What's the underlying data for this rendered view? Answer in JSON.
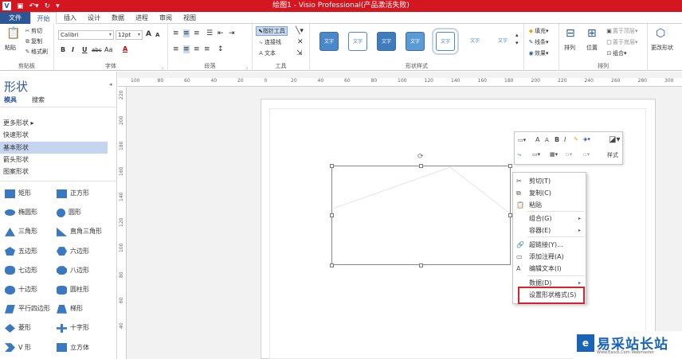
{
  "titlebar": {
    "title": "绘图1 - Visio Professional(产品激活失败)",
    "app_logo": "V",
    "quick_access": [
      "save-icon",
      "undo-icon",
      "redo-icon"
    ]
  },
  "tabs": [
    {
      "label": "文件"
    },
    {
      "label": "开始"
    },
    {
      "label": "插入"
    },
    {
      "label": "设计"
    },
    {
      "label": "数据"
    },
    {
      "label": "进程"
    },
    {
      "label": "审阅"
    },
    {
      "label": "视图"
    }
  ],
  "ribbon": {
    "clipboard": {
      "label": "剪贴板",
      "paste": "粘贴",
      "cut": "剪切",
      "copy": "复制",
      "format_painter": "格式刷"
    },
    "font": {
      "label": "字体",
      "font_name": "Calibri",
      "font_size": "12pt",
      "grow": "A",
      "shrink": "A",
      "bold": "B",
      "italic": "I",
      "underline": "U",
      "strike": "abc",
      "case": "Aa",
      "color": "A"
    },
    "paragraph": {
      "label": "段落"
    },
    "tools": {
      "label": "工具",
      "pointer": "指针工具",
      "connector": "连接线",
      "text": "文本"
    },
    "shape_styles": {
      "label": "形状样式",
      "style_text": "文字",
      "fill": "填充",
      "line": "线条",
      "effect": "效果"
    },
    "arrange": {
      "label": "排列",
      "arrange": "排列",
      "position": "位置",
      "bring_front": "置于顶层",
      "send_back": "置于底层",
      "group": "组合"
    },
    "edit": {
      "change_shape": "更改形状"
    }
  },
  "left_pane": {
    "title": "形状",
    "tab_stencil": "模具",
    "tab_search": "搜索",
    "more_shapes": "更多形状",
    "categories": [
      "快速形状",
      "基本形状",
      "箭头形状",
      "图案形状"
    ],
    "selected_category": "基本形状",
    "shapes": [
      [
        "矩形",
        "正方形"
      ],
      [
        "椭圆形",
        "圆形"
      ],
      [
        "三角形",
        "直角三角形"
      ],
      [
        "五边形",
        "六边形"
      ],
      [
        "七边形",
        "八边形"
      ],
      [
        "十边形",
        "圆柱形"
      ],
      [
        "平行四边形",
        "梯形"
      ],
      [
        "菱形",
        "十字形"
      ],
      [
        "V 形",
        "立方体"
      ]
    ]
  },
  "ruler": {
    "h_ticks": [
      "100",
      "80",
      "60",
      "40",
      "20",
      "0",
      "20",
      "40",
      "60",
      "80",
      "100",
      "120",
      "140",
      "160",
      "180",
      "200",
      "220",
      "240",
      "260",
      "280",
      "300"
    ],
    "v_ticks": [
      "220",
      "200",
      "180",
      "160",
      "140",
      "120",
      "100",
      "80",
      "60",
      "40"
    ]
  },
  "mini_toolbar": {
    "grow": "A",
    "shrink": "A",
    "bold": "B",
    "italic": "I",
    "style": "样式"
  },
  "context_menu": {
    "items": [
      {
        "label": "剪切(T)",
        "icon": "scissors-icon",
        "submenu": false
      },
      {
        "label": "复制(C)",
        "icon": "copy-icon",
        "submenu": false
      },
      {
        "label": "粘贴",
        "icon": "paste-icon",
        "submenu": false
      },
      {
        "label": "组合(G)",
        "icon": "",
        "submenu": true
      },
      {
        "label": "容器(E)",
        "icon": "",
        "submenu": true
      },
      {
        "label": "超链接(Y)...",
        "icon": "hyperlink-icon",
        "submenu": false
      },
      {
        "label": "添加注释(A)",
        "icon": "comment-icon",
        "submenu": false
      },
      {
        "label": "编辑文本(I)",
        "icon": "text-icon",
        "submenu": false
      },
      {
        "label": "数据(D)",
        "icon": "",
        "submenu": true
      },
      {
        "label": "设置形状格式(S)",
        "icon": "",
        "submenu": false
      }
    ]
  },
  "watermark": {
    "text": "易采站长站",
    "sub": "Www.Easck.Com Webmaster"
  },
  "colors": {
    "titlebar": "#d3161f",
    "file_tab": "#2b5797",
    "accent": "#2b579a",
    "highlight": "#d9222a",
    "shape_blue": "#3a78c2"
  }
}
